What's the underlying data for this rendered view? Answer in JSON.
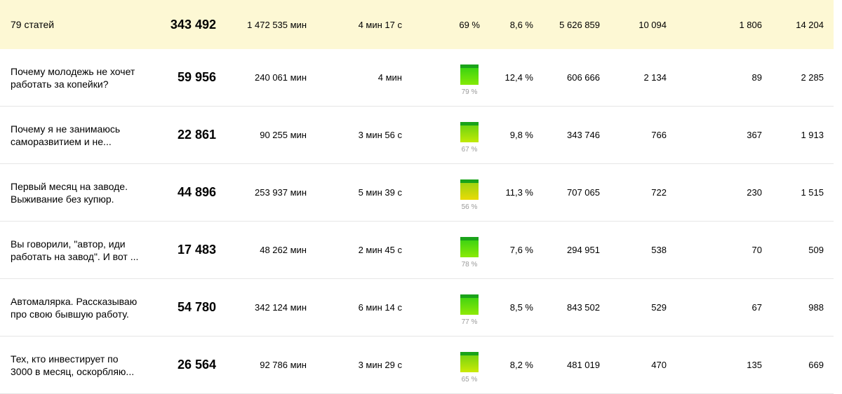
{
  "summary": {
    "title": "79 статей",
    "views": "343 492",
    "total_time": "1 472 535 мин",
    "avg_time": "4 мин 17 с",
    "read_pct": "69 %",
    "ctr": "8,6 %",
    "shows": "5 626 859",
    "subs": "10 094",
    "likes": "1 806",
    "comments": "14 204"
  },
  "rows": [
    {
      "title": "Почему молодежь не хочет работать за копейки?",
      "views": "59 956",
      "total_time": "240 061 мин",
      "avg_time": "4 мин",
      "read_pct": "79 %",
      "read_value": 79,
      "ctr": "12,4 %",
      "shows": "606 666",
      "subs": "2 134",
      "likes": "89",
      "comments": "2 285"
    },
    {
      "title": "Почему я не занимаюсь саморазвитием и не...",
      "views": "22 861",
      "total_time": "90 255 мин",
      "avg_time": "3 мин 56 с",
      "read_pct": "67 %",
      "read_value": 67,
      "ctr": "9,8 %",
      "shows": "343 746",
      "subs": "766",
      "likes": "367",
      "comments": "1 913"
    },
    {
      "title": "Первый месяц на заводе. Выживание без купюр.",
      "views": "44 896",
      "total_time": "253 937 мин",
      "avg_time": "5 мин 39 с",
      "read_pct": "56 %",
      "read_value": 56,
      "ctr": "11,3 %",
      "shows": "707 065",
      "subs": "722",
      "likes": "230",
      "comments": "1 515"
    },
    {
      "title": "Вы говорили, \"автор, иди работать на завод\". И вот ...",
      "views": "17 483",
      "total_time": "48 262 мин",
      "avg_time": "2 мин 45 с",
      "read_pct": "78 %",
      "read_value": 78,
      "ctr": "7,6 %",
      "shows": "294 951",
      "subs": "538",
      "likes": "70",
      "comments": "509"
    },
    {
      "title": "Автомалярка. Рассказываю про свою бывшую работу.",
      "views": "54 780",
      "total_time": "342 124 мин",
      "avg_time": "6 мин 14 с",
      "read_pct": "77 %",
      "read_value": 77,
      "ctr": "8,5 %",
      "shows": "843 502",
      "subs": "529",
      "likes": "67",
      "comments": "988"
    },
    {
      "title": "Тех, кто инвестирует по 3000 в месяц, оскорбляю...",
      "views": "26 564",
      "total_time": "92 786 мин",
      "avg_time": "3 мин 29 с",
      "read_pct": "65 %",
      "read_value": 65,
      "ctr": "8,2 %",
      "shows": "481 019",
      "subs": "470",
      "likes": "135",
      "comments": "669"
    }
  ]
}
